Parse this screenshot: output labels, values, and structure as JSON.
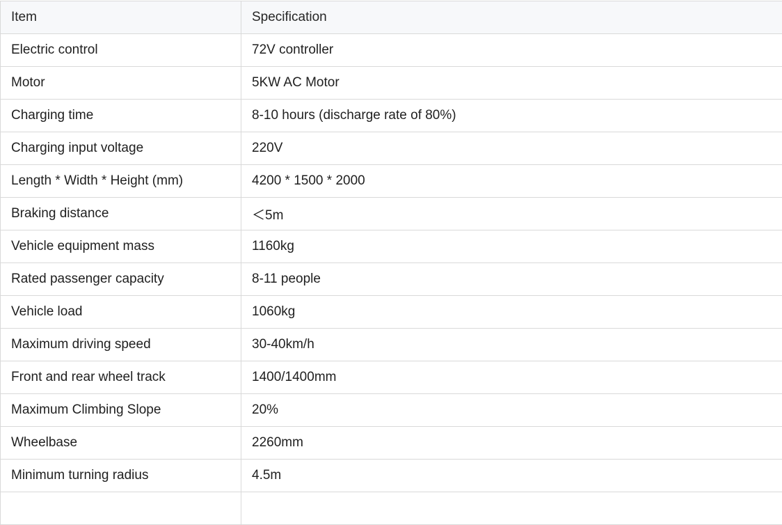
{
  "table": {
    "headers": [
      "Item",
      "Specification"
    ],
    "rows": [
      [
        "Electric control",
        "72V controller"
      ],
      [
        "Motor",
        "5KW AC Motor"
      ],
      [
        "Charging time",
        "8-10 hours (discharge rate of 80%)"
      ],
      [
        "Charging input voltage",
        "220V"
      ],
      [
        "Length * Width * Height (mm)",
        "4200 * 1500 * 2000"
      ],
      [
        "Braking distance",
        "＜5m"
      ],
      [
        "Vehicle equipment mass",
        "1160kg"
      ],
      [
        "Rated passenger capacity",
        "8-11 people"
      ],
      [
        "Vehicle load",
        "1060kg"
      ],
      [
        "Maximum driving speed",
        "30-40km/h"
      ],
      [
        "Front and rear wheel track",
        "1400/1400mm"
      ],
      [
        "Maximum Climbing Slope",
        "20%"
      ],
      [
        "Wheelbase",
        "2260mm"
      ],
      [
        "Minimum turning radius",
        "4.5m"
      ],
      [
        "",
        ""
      ]
    ]
  },
  "colors": {
    "header_background": "#f7f8fa",
    "border": "#d9d9d9",
    "text": "#1f1f1f"
  }
}
